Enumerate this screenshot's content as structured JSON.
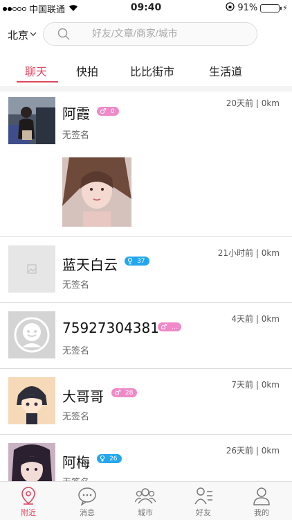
{
  "status": {
    "carrier": "中国联通",
    "time": "09:40",
    "battery": "91%",
    "battery_level": 0.91
  },
  "header": {
    "city": "北京",
    "search_placeholder": "好友/文章/商家/城市"
  },
  "tabs": [
    {
      "label": "聊天",
      "active": true
    },
    {
      "label": "快拍"
    },
    {
      "label": "比比街市"
    },
    {
      "label": "生活道"
    }
  ],
  "items": [
    {
      "name": "阿霞",
      "badge_symbol": "♂",
      "badge_value": "0",
      "badge_color": "#f089c8",
      "signature": "无签名",
      "meta": "20天前 | 0km"
    },
    {
      "name": "蓝天白云",
      "badge_symbol": "♀",
      "badge_value": "37",
      "badge_color": "#23a7ee",
      "signature": "无签名",
      "meta": "21小时前 | 0km"
    },
    {
      "name": "75927304381",
      "badge_symbol": "♂",
      "badge_value": "...",
      "badge_color": "#f089c8",
      "signature": "无签名",
      "meta": "4天前 | 0km"
    },
    {
      "name": "大哥哥",
      "badge_symbol": "♂",
      "badge_value": "28",
      "badge_color": "#f089c8",
      "signature": "无签名",
      "meta": "7天前 | 0km"
    },
    {
      "name": "阿梅",
      "badge_symbol": "♀",
      "badge_value": "26",
      "badge_color": "#23a7ee",
      "signature": "无签名",
      "meta": "26天前 | 0km"
    }
  ],
  "nav": [
    {
      "label": "附近",
      "icon": "location-pin-icon",
      "active": true
    },
    {
      "label": "消息",
      "icon": "chat-bubble-icon"
    },
    {
      "label": "城市",
      "icon": "people-group-icon"
    },
    {
      "label": "好友",
      "icon": "friends-list-icon"
    },
    {
      "label": "我的",
      "icon": "person-icon"
    }
  ],
  "colors": {
    "accent": "#e0455f",
    "badge_pink": "#f089c8",
    "badge_blue": "#23a7ee"
  }
}
